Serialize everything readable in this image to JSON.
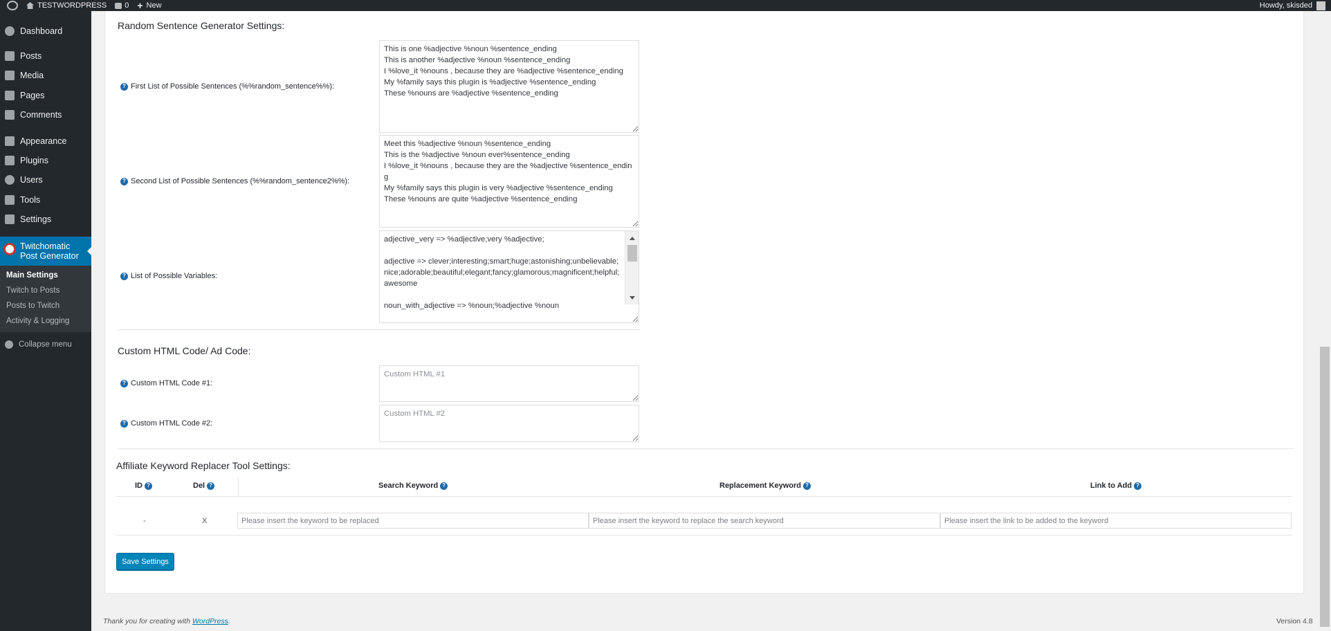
{
  "adminbar": {
    "site_name": "TESTWORDPRESS",
    "comments_count": "0",
    "new_label": "New",
    "howdy": "Howdy, skisded"
  },
  "sidebar": {
    "items": [
      {
        "label": "Dashboard",
        "icon": "dashboard-icon"
      },
      {
        "label": "Posts",
        "icon": "pin-icon"
      },
      {
        "label": "Media",
        "icon": "media-icon"
      },
      {
        "label": "Pages",
        "icon": "pages-icon"
      },
      {
        "label": "Comments",
        "icon": "comment-icon"
      },
      {
        "label": "Appearance",
        "icon": "brush-icon"
      },
      {
        "label": "Plugins",
        "icon": "plug-icon"
      },
      {
        "label": "Users",
        "icon": "user-icon"
      },
      {
        "label": "Tools",
        "icon": "wrench-icon"
      },
      {
        "label": "Settings",
        "icon": "settings-icon"
      }
    ],
    "current": "Twitchomatic Post Generator",
    "submenu": [
      "Main Settings",
      "Twitch to Posts",
      "Posts to Twitch",
      "Activity & Logging"
    ],
    "collapse": "Collapse menu"
  },
  "random_sentence": {
    "heading": "Random Sentence Generator Settings:",
    "first_label": "First List of Possible Sentences (%%random_sentence%%):",
    "first_value": "This is one %adjective %noun %sentence_ending\nThis is another %adjective %noun %sentence_ending\nI %love_it %nouns , because they are %adjective %sentence_ending\nMy %family says this plugin is %adjective %sentence_ending\nThese %nouns are %adjective %sentence_ending",
    "second_label": "Second List of Possible Sentences (%%random_sentence2%%):",
    "second_value": "Meet this %adjective %noun %sentence_ending\nThis is the %adjective %noun ever%sentence_ending\nI %love_it %nouns , because they are the %adjective %sentence_ending\nMy %family says this plugin is very %adjective %sentence_ending\nThese %nouns are quite %adjective %sentence_ending",
    "vars_label": "List of Possible Variables:",
    "vars_value": "adjective_very => %adjective;very %adjective;\n\nadjective => clever;interesting;smart;huge;astonishing;unbelievable;nice;adorable;beautiful;elegant;fancy;glamorous;magnificent;helpful;awesome\n\nnoun_with_adjective => %noun;%adjective %noun"
  },
  "custom_html": {
    "heading": "Custom HTML Code/ Ad Code:",
    "code1_label": "Custom HTML Code #1:",
    "code1_placeholder": "Custom HTML #1",
    "code2_label": "Custom HTML Code #2:",
    "code2_placeholder": "Custom HTML #2"
  },
  "affiliate": {
    "heading": "Affiliate Keyword Replacer Tool Settings:",
    "columns": {
      "id": "ID",
      "del": "Del",
      "search": "Search Keyword",
      "replacement": "Replacement Keyword",
      "link": "Link to Add"
    },
    "row": {
      "id": "-",
      "del": "X",
      "search_placeholder": "Please insert the keyword to be replaced",
      "replacement_placeholder": "Please insert the keyword to replace the search keyword",
      "link_placeholder": "Please insert the link to be added to the keyword"
    }
  },
  "save_label": "Save Settings",
  "footer": {
    "thanks": "Thank you for creating with",
    "wp_link": "WordPress",
    "period": ".",
    "version": "Version 4.8"
  },
  "colors": {
    "accent": "#0073aa",
    "sidebar_bg": "#23282d",
    "button": "#0085ba",
    "help_icon": "#1e6aa8"
  }
}
